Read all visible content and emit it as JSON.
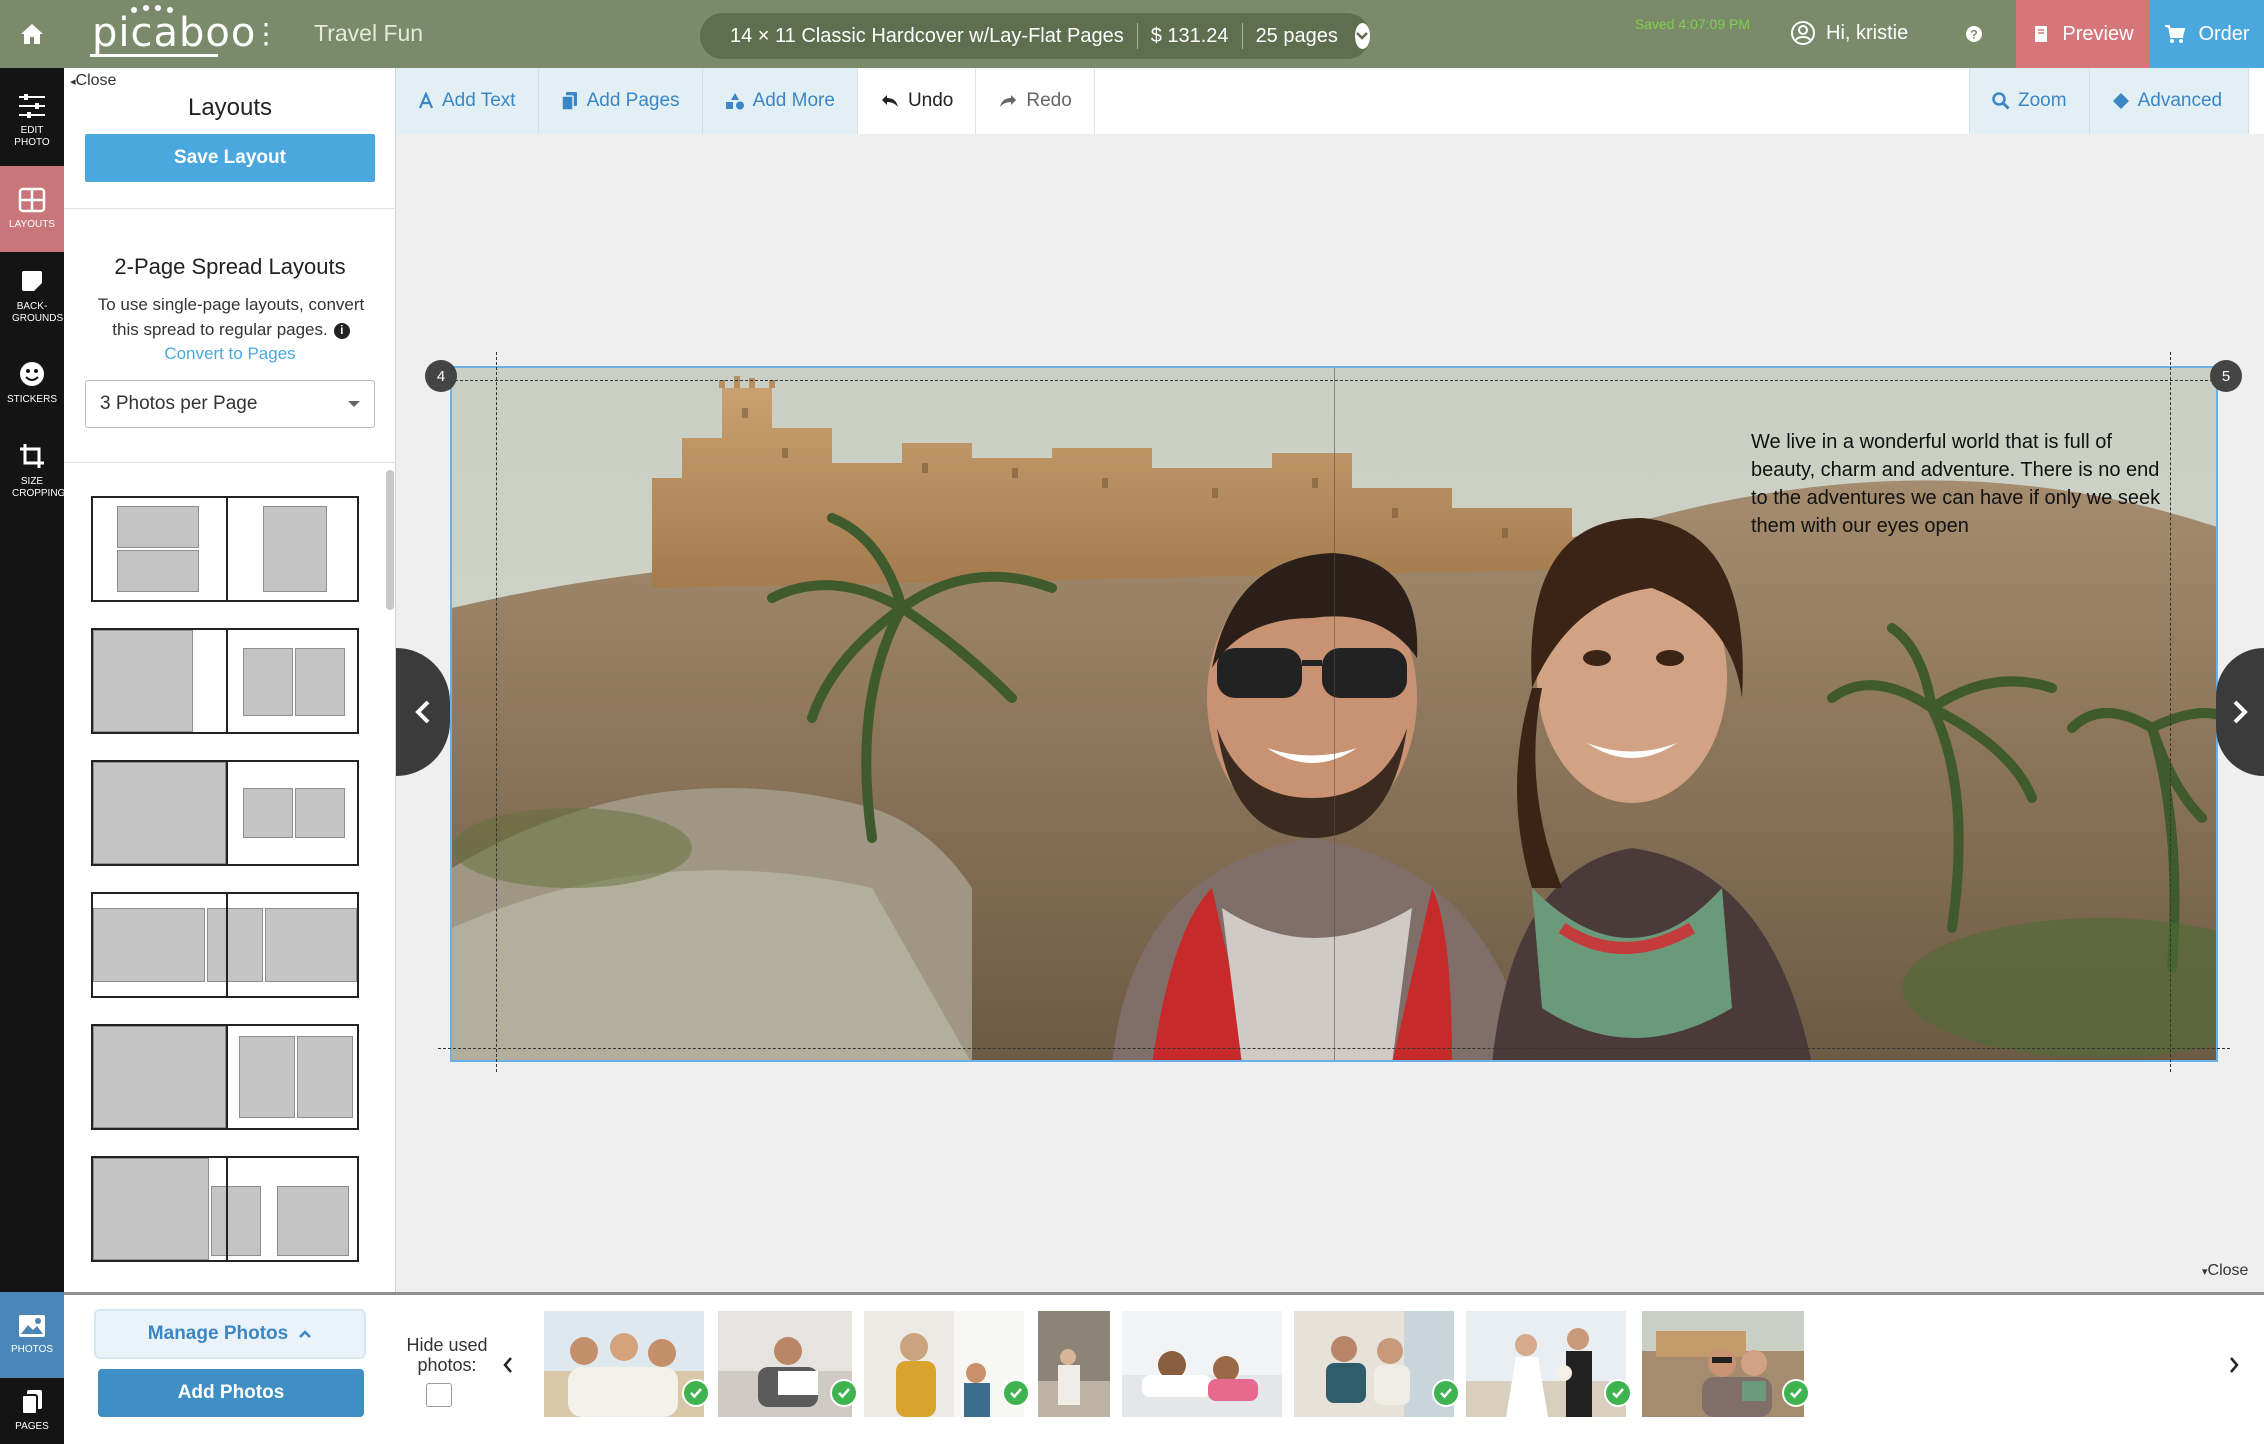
{
  "app": {
    "logo_text": "picaboo",
    "project_title": "Travel Fun",
    "product": {
      "name": "14 × 11 Classic Hardcover w/Lay-Flat Pages",
      "price": "$ 131.24",
      "pages": "25 pages"
    },
    "saved_status": "Saved 4:07:09 PM",
    "user_greeting": "Hi, kristie",
    "preview_label": "Preview",
    "order_label": "Order"
  },
  "rail": {
    "items": [
      {
        "label": "EDIT PHOTO",
        "icon": "sliders-icon"
      },
      {
        "label": "LAYOUTS",
        "icon": "grid-icon"
      },
      {
        "label": "BACK-GROUNDS",
        "icon": "background-icon"
      },
      {
        "label": "STICKERS",
        "icon": "smiley-icon"
      },
      {
        "label": "SIZE CROPPING",
        "icon": "crop-icon"
      }
    ],
    "bottom": [
      {
        "label": "PHOTOS",
        "icon": "image-icon"
      },
      {
        "label": "PAGES",
        "icon": "pages-icon"
      }
    ]
  },
  "panel": {
    "close_label": "Close",
    "title": "Layouts",
    "save_layout": "Save Layout",
    "spread_title": "2-Page Spread Layouts",
    "spread_desc": "To use single-page layouts, convert this spread to regular pages.",
    "convert_link": "Convert to Pages",
    "select_value": "3 Photos per Page"
  },
  "toolbar": {
    "add_text": "Add Text",
    "add_pages": "Add Pages",
    "add_more": "Add More",
    "undo": "Undo",
    "redo": "Redo",
    "zoom": "Zoom",
    "advanced": "Advanced"
  },
  "canvas": {
    "left_page_number": "4",
    "right_page_number": "5",
    "spread_text": "We live in a wonderful world that is full of beauty, charm and adventure. There is no end to the adventures we can have if only we seek them with our eyes open",
    "close_label": "Close"
  },
  "tray": {
    "manage_photos": "Manage Photos",
    "add_photos": "Add Photos",
    "hide_used": "Hide used photos:"
  },
  "colors": {
    "topbar": "#7b8a6a",
    "accent_blue": "#4aa8de",
    "preview_pink": "#d6767a",
    "saved_green": "#7ed24a",
    "check_green": "#3fb34f"
  }
}
